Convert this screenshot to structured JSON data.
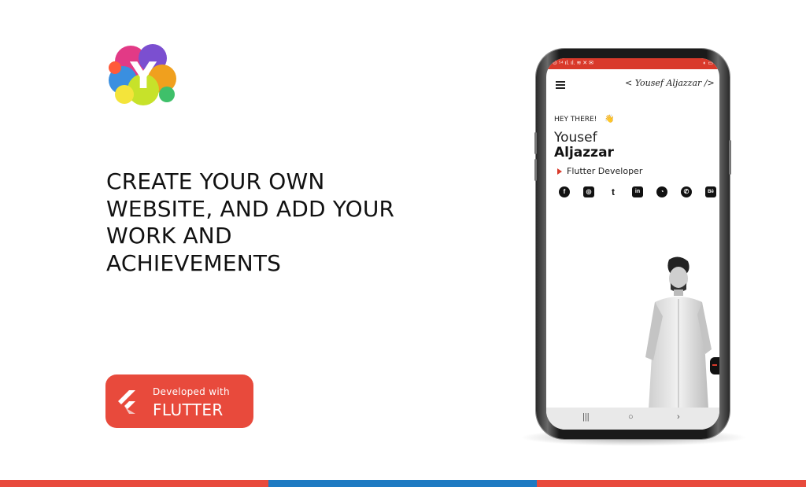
{
  "logo": {
    "letter": "Y"
  },
  "headline": {
    "lines": [
      "CREATE YOUR OWN",
      "WEBSITE, AND ADD YOUR",
      "WORK AND",
      "ACHIEVEMENTS"
    ]
  },
  "badge": {
    "small_text": "Developed with",
    "big_text": "FLUTTER",
    "icon": "flutter-logo-icon",
    "color": "#e84a3c"
  },
  "phone": {
    "status_left": "⊙ ⁵⁴ ıl. ıl. ≋ ✕ ✉",
    "status_right": "◐ ▭",
    "signature": "< Yousef Aljazzar />",
    "greeting": "HEY THERE!",
    "wave": "👋",
    "first_name": "Yousef",
    "last_name": "Aljazzar",
    "role": "Flutter Developer",
    "socials": [
      {
        "name": "facebook-icon",
        "glyph": "f"
      },
      {
        "name": "instagram-icon",
        "glyph": "◎"
      },
      {
        "name": "twitter-icon",
        "glyph": "t"
      },
      {
        "name": "linkedin-icon",
        "glyph": "in"
      },
      {
        "name": "github-icon",
        "glyph": "◔"
      },
      {
        "name": "whatsapp-icon",
        "glyph": "✆"
      },
      {
        "name": "behance-icon",
        "glyph": "Bē"
      }
    ],
    "nav": {
      "recent": "|||",
      "home": "○",
      "back": "›"
    }
  },
  "colors": {
    "accent_red": "#e84a3c",
    "accent_blue": "#1e7ac2"
  }
}
